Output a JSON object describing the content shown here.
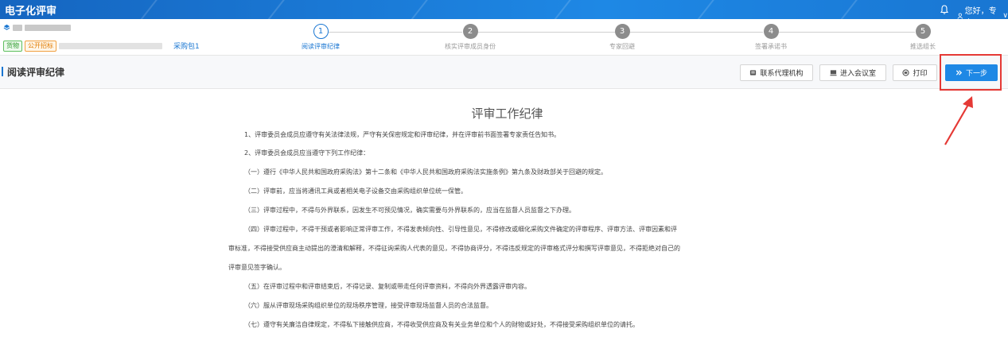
{
  "header": {
    "app_title": "电子化评审",
    "user_greeting": "您好，专家二",
    "dropdown_glyph": "∨"
  },
  "project": {
    "tag_goods": "货物",
    "tag_public": "公开招标",
    "package": "采购包1"
  },
  "steps": [
    {
      "num": "1",
      "label": "阅读评审纪律",
      "active": true
    },
    {
      "num": "2",
      "label": "核实评审成员身份",
      "active": false
    },
    {
      "num": "3",
      "label": "专家回避",
      "active": false
    },
    {
      "num": "4",
      "label": "签署承诺书",
      "active": false
    },
    {
      "num": "5",
      "label": "推选组长",
      "active": false
    }
  ],
  "section": {
    "title": "阅读评审纪律",
    "btn_contact": "联系代理机构",
    "btn_meeting": "进入会议室",
    "btn_print": "打印",
    "btn_next": "下一步"
  },
  "document": {
    "title": "评审工作纪律",
    "paragraphs": [
      "1、评审委员会成员应遵守有关法律法规，严守有关保密规定和评审纪律，并在评审前书面签署专家责任告知书。",
      "2、评审委员会成员应当遵守下列工作纪律：",
      "（一）遵行《中华人民共和国政府采购法》第十二条和《中华人民共和国政府采购法实施条例》第九条及财政部关于回避的规定。",
      "（二）评审前，应当将通讯工具或者相关电子设备交由采购组织单位统一保管。",
      "（三）评审过程中，不得与外界联系，因发生不可预见情况，确实需要与外界联系的，应当在监督人员监督之下办理。",
      "（四）评审过程中，不得干预或者影响正常评审工作，不得发表倾向性、引导性意见，不得修改或细化采购文件确定的评审程序、评审方法、评审因素和评",
      "审标准，不得接受供应商主动提出的澄清和解释，不得征询采购人代表的意见，不得协商评分，不得违反规定的评审格式评分和撰写评审意见，不得拒绝对自己的",
      "评审意见签字确认。",
      "（五）在评审过程中和评审结束后，不得记录、复制或带走任何评审资料，不得向外界透露评审内容。",
      "（六）服从评审现场采购组织单位的现场秩序管理，接受评审现场监督人员的合法监督。",
      "（七）遵守有关廉洁自律规定，不得私下接触供应商，不得收受供应商及有关业务单位和个人的财物或好处，不得接受采购组织单位的请托。"
    ]
  },
  "colors": {
    "primary": "#1e88e5",
    "highlight": "#e53935"
  }
}
